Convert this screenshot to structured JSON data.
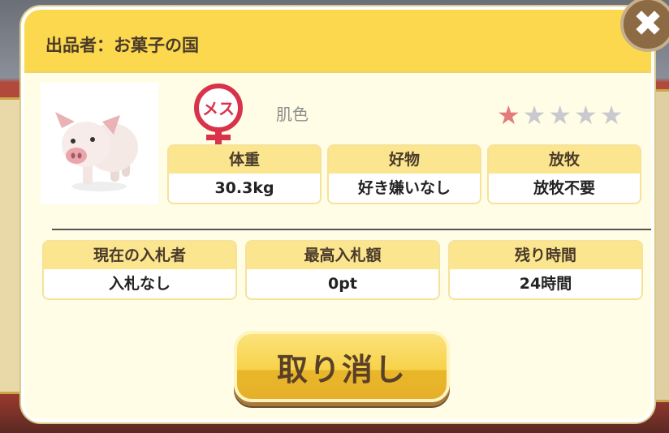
{
  "background": {
    "top_label": ""
  },
  "modal": {
    "seller_line": "出品者：お菓子の国",
    "close_label": "✖"
  },
  "pig": {
    "gender_text": "メス",
    "color": "肌色",
    "stars_total": 5,
    "stars_filled": 1
  },
  "stats": {
    "weight": {
      "label": "体重",
      "value": "30.3kg"
    },
    "likes": {
      "label": "好物",
      "value": "好き嫌いなし"
    },
    "grazing": {
      "label": "放牧",
      "value": "放牧不要"
    }
  },
  "auction": {
    "bidder": {
      "label": "現在の入札者",
      "value": "入札なし"
    },
    "max_bid": {
      "label": "最高入札額",
      "value": "0pt"
    },
    "remaining": {
      "label": "残り時間",
      "value": "24時間"
    }
  },
  "actions": {
    "cancel_label": "取り消し"
  },
  "colors": {
    "header_yellow": "#fbd84d",
    "panel_cream": "#fffde6",
    "gender_red": "#d8334a",
    "star_on": "#e47b7b",
    "star_off": "#c9c9cf"
  }
}
